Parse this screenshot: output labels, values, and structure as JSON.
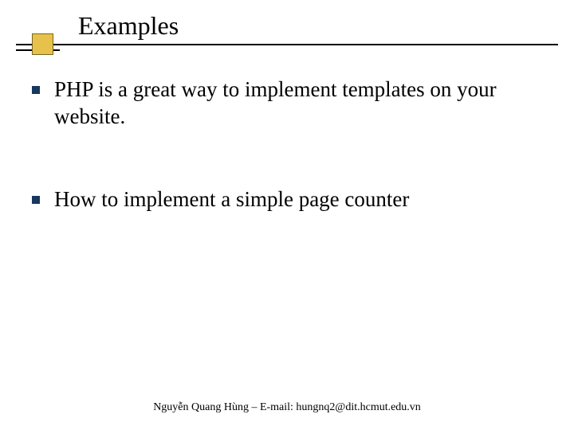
{
  "title": "Examples",
  "bullets": [
    "PHP is a great way to implement templates on your website.",
    "How to implement a simple page counter"
  ],
  "footer": "Nguyễn Quang Hùng – E-mail: hungnq2@dit.hcmut.edu.vn"
}
